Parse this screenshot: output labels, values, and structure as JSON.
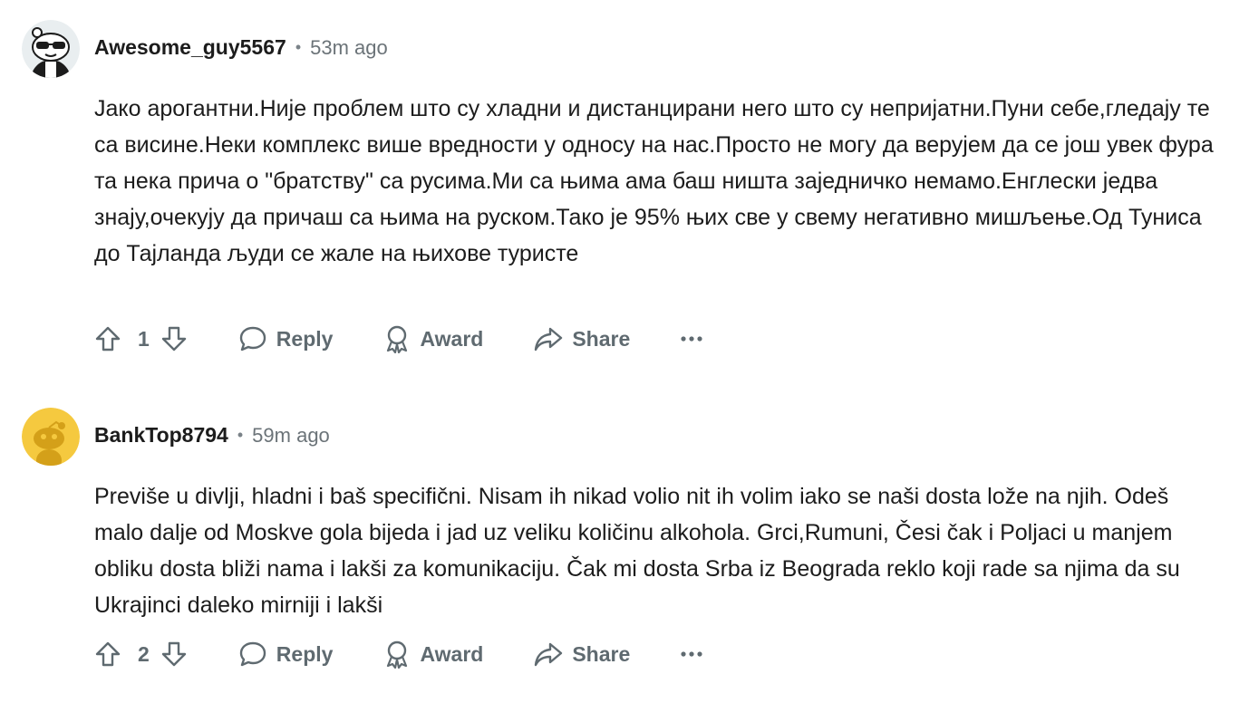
{
  "comments": [
    {
      "username": "Awesome_guy5567",
      "separator": "•",
      "time": "53m ago",
      "text": "Јако арогантни.Није проблем што су хладни и дистанцирани него што су непријатни.Пуни себе,гледају те са висине.Неки комплекс више вредности у односу на нас.Просто не могу да верујем да се још увек фура та нека прича о \"братству\" са русима.Ми са њима ама баш ништа заједничко немамо.Енглески једва знају,очекују да причаш са њима на руском.Тако је 95% њих све у свему негативно мишљење.Од Туниса до Тајланда људи се жале на њихове туристе",
      "score": "1",
      "reply_label": "Reply",
      "award_label": "Award",
      "share_label": "Share",
      "more_label": "•••",
      "avatar": "snoo-sunglasses-avatar"
    },
    {
      "username": "BankTop8794",
      "separator": "•",
      "time": "59m ago",
      "text": "Previše u divlji, hladni i baš specifični. Nisam ih nikad volio nit ih volim iako se naši dosta lože na njih. Odeš malo dalje od Moskve gola bijeda i jad uz veliku količinu alkohola. Grci,Rumuni, Česi čak i Poljaci u manjem obliku dosta bliži nama i lakši za komunikaciju. Čak mi dosta Srba iz Beograda reklo koji rade sa njima da su Ukrajinci daleko mirniji i lakši",
      "score": "2",
      "reply_label": "Reply",
      "award_label": "Award",
      "share_label": "Share",
      "more_label": "•••",
      "avatar": "snoo-default-yellow-avatar"
    }
  ],
  "colors": {
    "text": "#1c1c1c",
    "muted": "#5f6a70",
    "avatar_yellow": "#f5c93f"
  }
}
